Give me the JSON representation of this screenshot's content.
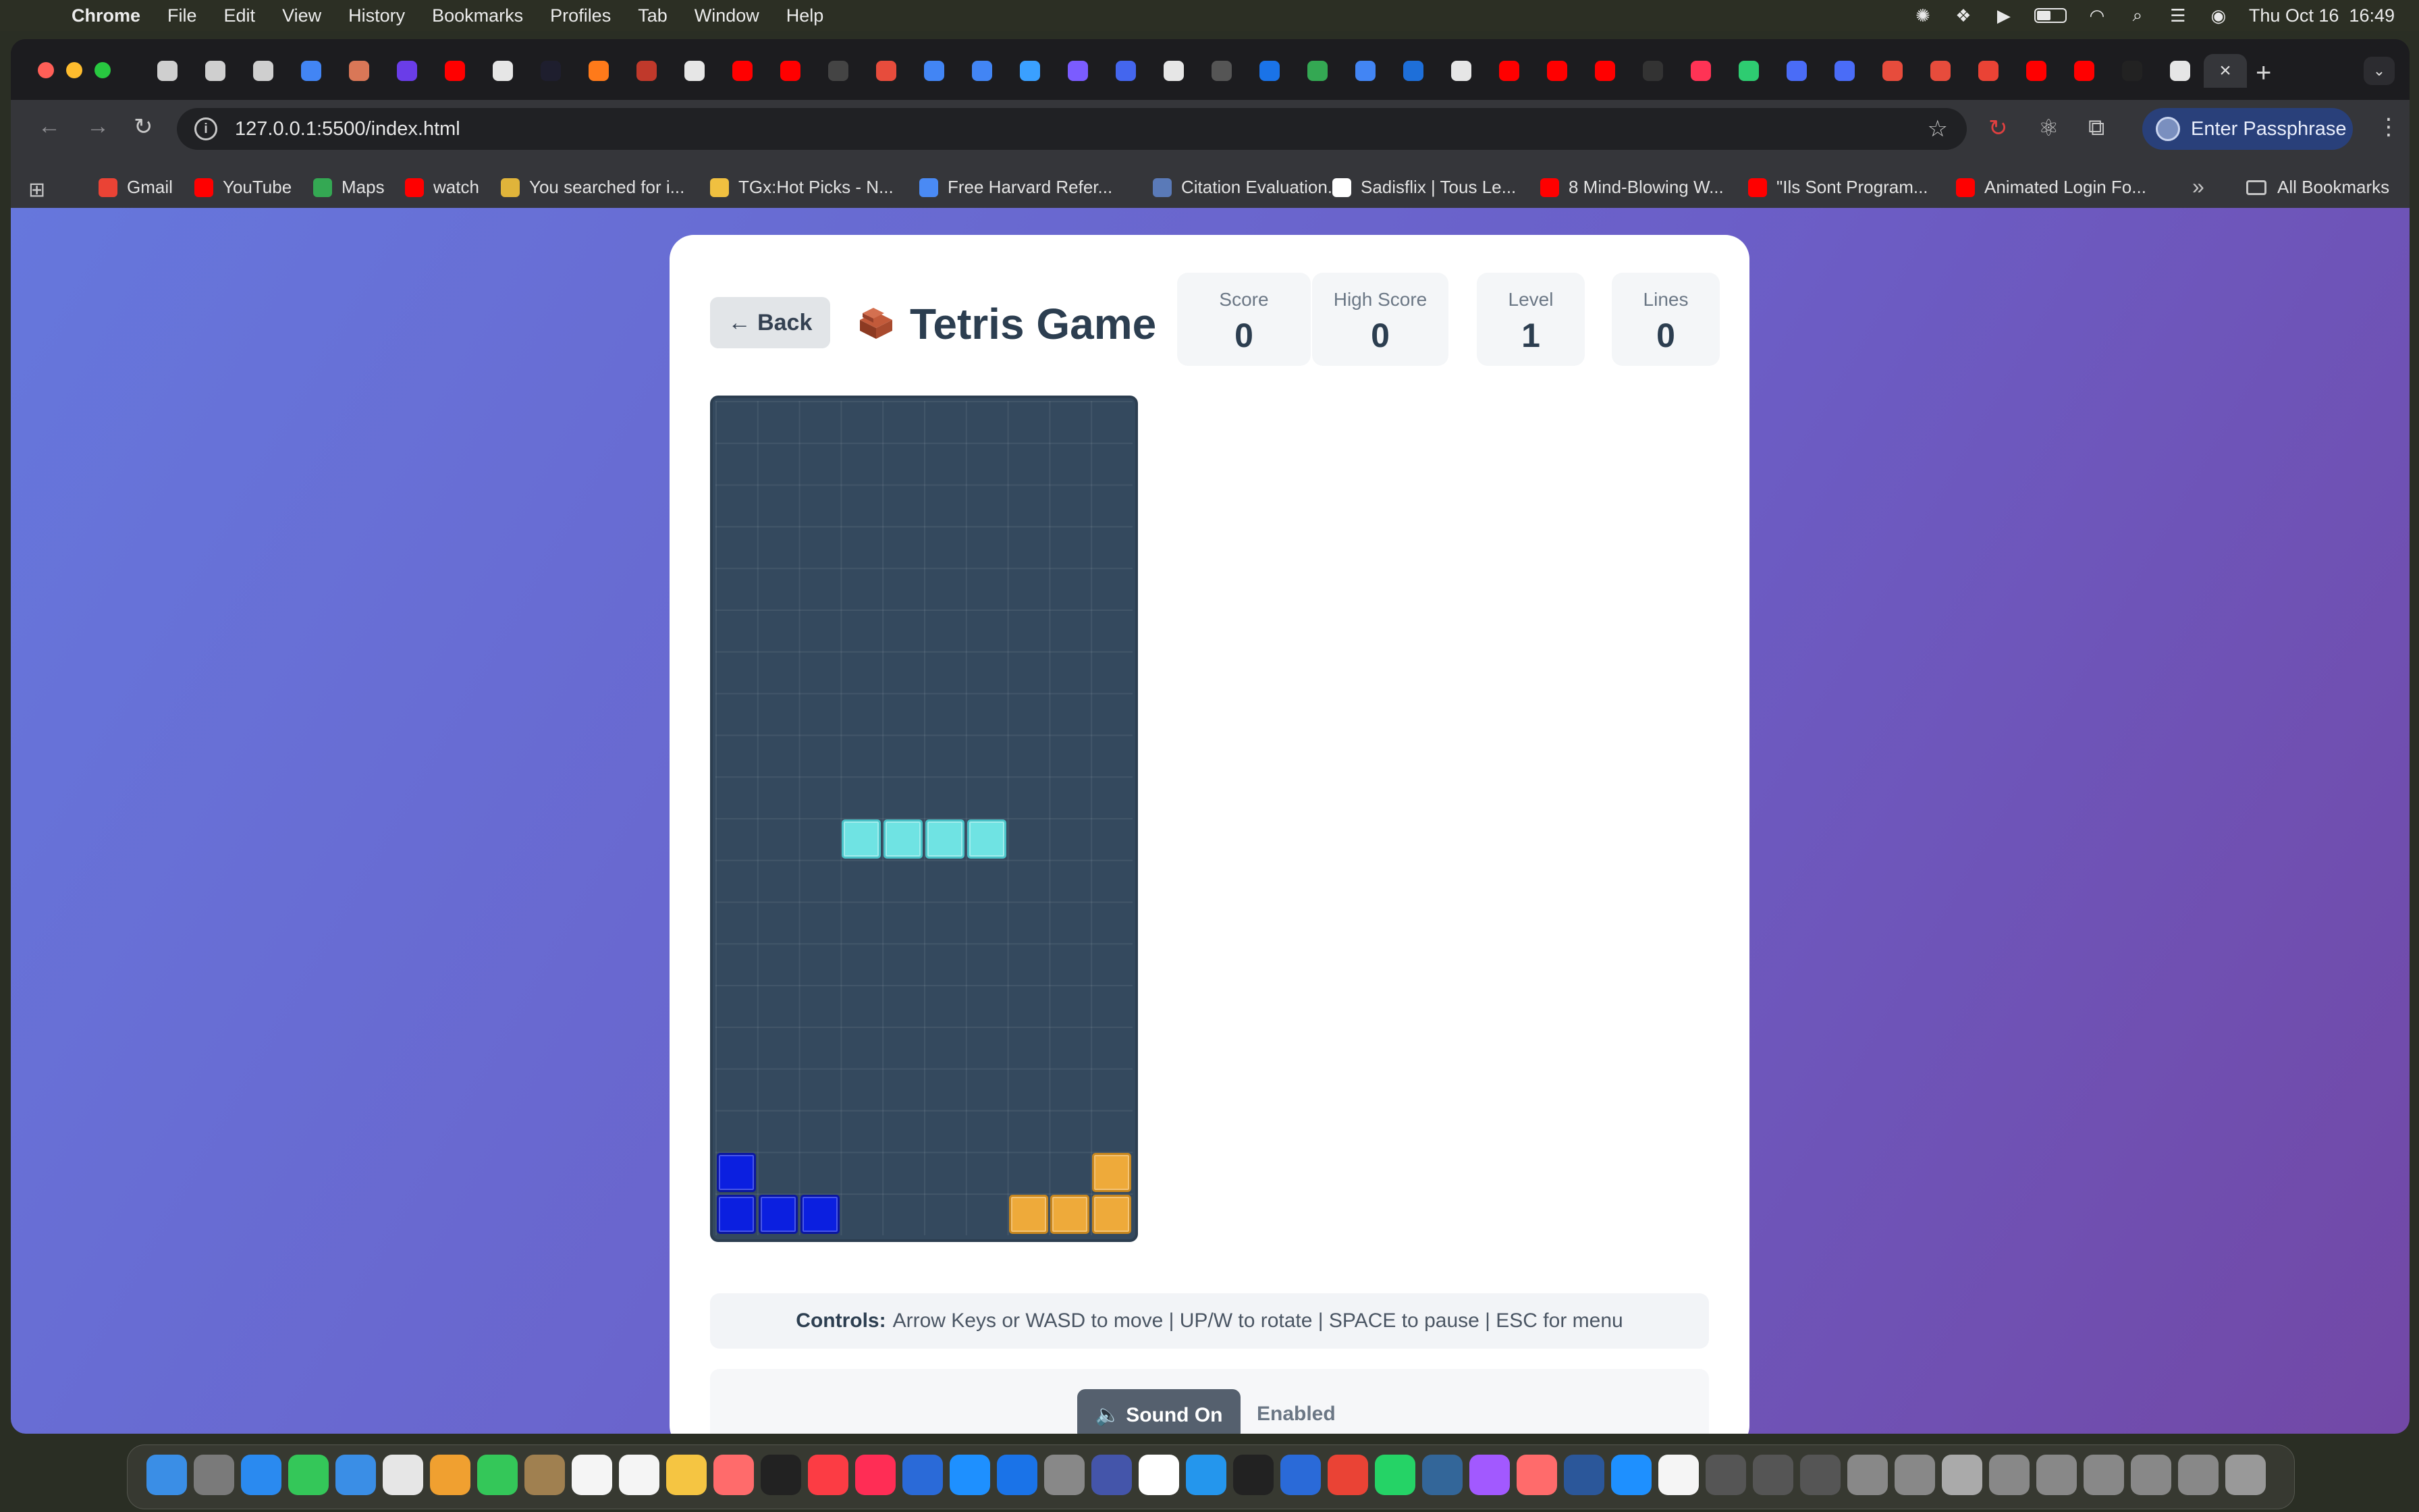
{
  "menubar": {
    "app_name": "Chrome",
    "items": [
      "File",
      "Edit",
      "View",
      "History",
      "Bookmarks",
      "Profiles",
      "Tab",
      "Window",
      "Help"
    ],
    "datetime": "Thu Oct 16  16:49"
  },
  "browser": {
    "url": "127.0.0.1:5500/index.html",
    "profile_button": "Enter Passphrase",
    "bookmarks": [
      {
        "label": "Gmail",
        "color": "#ea4335"
      },
      {
        "label": "YouTube",
        "color": "#ff0000"
      },
      {
        "label": "Maps",
        "color": "#34a853"
      },
      {
        "label": "watch",
        "color": "#ff0000"
      },
      {
        "label": "You searched for i...",
        "color": "#e0b43a"
      },
      {
        "label": "TGx:Hot Picks - N...",
        "color": "#f0c040"
      },
      {
        "label": "Free Harvard Refer...",
        "color": "#4a8af4"
      },
      {
        "label": "Citation Evaluation...",
        "color": "#5a7ab8"
      },
      {
        "label": "Sadisflix | Tous Le...",
        "color": "#ffffff"
      },
      {
        "label": "8 Mind-Blowing W...",
        "color": "#ff0000"
      },
      {
        "label": "\"Ils Sont Program...",
        "color": "#ff0000"
      },
      {
        "label": "Animated Login Fo...",
        "color": "#ff0000"
      }
    ],
    "all_bookmarks": "All Bookmarks"
  },
  "game": {
    "back_label": "← Back",
    "title": "Tetris Game",
    "stats": [
      {
        "label": "Score",
        "value": "0"
      },
      {
        "label": "High Score",
        "value": "0"
      },
      {
        "label": "Level",
        "value": "1"
      },
      {
        "label": "Lines",
        "value": "0"
      }
    ],
    "board": {
      "columns": 10,
      "rows": 20,
      "blocks": [
        {
          "col": 3,
          "row": 10,
          "type": "I"
        },
        {
          "col": 4,
          "row": 10,
          "type": "I"
        },
        {
          "col": 5,
          "row": 10,
          "type": "I"
        },
        {
          "col": 6,
          "row": 10,
          "type": "I"
        },
        {
          "col": 0,
          "row": 18,
          "type": "J"
        },
        {
          "col": 0,
          "row": 19,
          "type": "J"
        },
        {
          "col": 1,
          "row": 19,
          "type": "J"
        },
        {
          "col": 2,
          "row": 19,
          "type": "J"
        },
        {
          "col": 9,
          "row": 18,
          "type": "L"
        },
        {
          "col": 7,
          "row": 19,
          "type": "L"
        },
        {
          "col": 8,
          "row": 19,
          "type": "L"
        },
        {
          "col": 9,
          "row": 19,
          "type": "L"
        }
      ]
    },
    "controls_label": "Controls:",
    "controls_text": "Arrow Keys or WASD to move | UP/W to rotate | SPACE to pause | ESC for menu",
    "sound_button": "🔈 Sound On",
    "sound_status": "Enabled"
  },
  "colors": {
    "accent_gradient_start": "#6677dc",
    "accent_gradient_end": "#7248a6",
    "board_bg": "#34495e",
    "piece_I": "#6fe3e3",
    "piece_J": "#0b1fe0",
    "piece_L": "#eeaa3a"
  }
}
